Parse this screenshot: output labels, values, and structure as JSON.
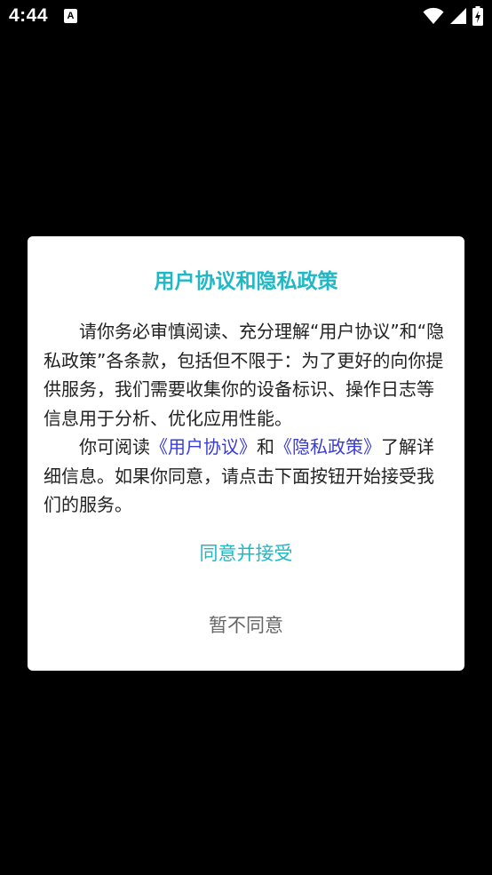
{
  "status_bar": {
    "time": "4:44",
    "notification_icon": "a-icon",
    "notification_letter": "A",
    "right_icons": [
      "wifi-icon",
      "signal-icon",
      "battery-icon"
    ]
  },
  "dialog": {
    "title": "用户协议和隐私政策",
    "paragraph1": "请你务必审慎阅读、充分理解“用户协议”和“隐私政策”各条款，包括但不限于：为了更好的向你提供服务，我们需要收集你的设备标识、操作日志等信息用于分析、优化应用性能。",
    "paragraph2_prefix": "你可阅读",
    "user_agreement_link": "《用户协议》",
    "paragraph2_and": "和",
    "privacy_policy_link": "《隐私政策》",
    "paragraph2_suffix": "了解详细信息。如果你同意，请点击下面按钮开始接受我们的服务。",
    "accept_label": "同意并接受",
    "decline_label": "暂不同意"
  },
  "colors": {
    "accent": "#1fb8c4",
    "link": "#3a3cd6",
    "background": "#000000",
    "dialog": "#ffffff"
  }
}
